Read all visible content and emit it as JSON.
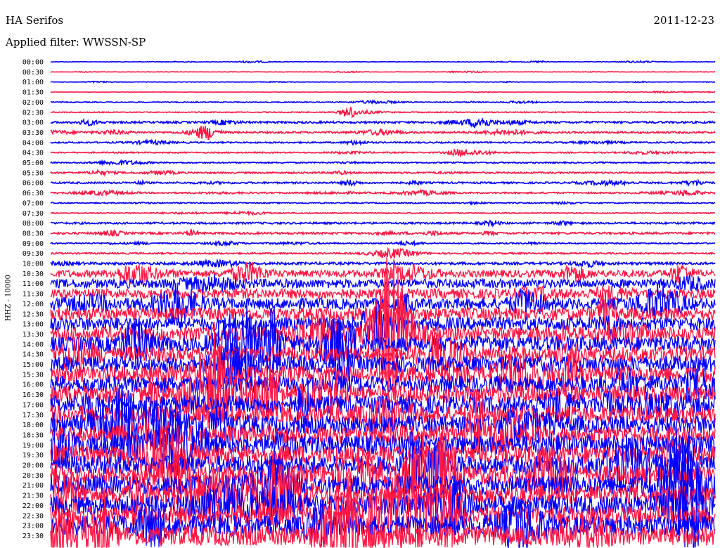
{
  "header": {
    "station": "HA Serifos",
    "date": "2011-12-23",
    "filter_label": "Applied filter: WWSSN-SP"
  },
  "chart_data": {
    "type": "line",
    "title": "HA Serifos",
    "subtitle": "Applied filter: WWSSN-SP",
    "ylabel": "HHZ - 10000",
    "xlabel": "",
    "grid": false,
    "row_interval_minutes": 30,
    "tick_labels": [
      "00:00",
      "00:30",
      "01:00",
      "01:30",
      "02:00",
      "02:30",
      "03:00",
      "03:30",
      "04:00",
      "04:30",
      "05:00",
      "05:30",
      "06:00",
      "06:30",
      "07:00",
      "07:30",
      "08:00",
      "08:30",
      "09:00",
      "09:30",
      "10:00",
      "10:30",
      "11:00",
      "11:30",
      "12:00",
      "12:30",
      "13:00",
      "13:30",
      "14:00",
      "14:30",
      "15:00",
      "15:30",
      "16:00",
      "16:30",
      "17:00",
      "17:30",
      "18:00",
      "18:30",
      "19:00",
      "19:30",
      "20:00",
      "20:30",
      "21:00",
      "21:30",
      "22:00",
      "22:30",
      "23:00",
      "23:30"
    ],
    "series": [
      {
        "name": "",
        "color": "#0000ff"
      },
      {
        "name": "",
        "color": "#ff1744"
      }
    ],
    "relative_amplitude": [
      0.12,
      0.1,
      0.1,
      0.08,
      0.2,
      0.22,
      0.45,
      0.4,
      0.32,
      0.28,
      0.3,
      0.35,
      0.38,
      0.33,
      0.25,
      0.22,
      0.42,
      0.45,
      0.3,
      0.35,
      0.55,
      1.6,
      2.0,
      2.2,
      2.5,
      2.8,
      3.0,
      3.2,
      3.4,
      3.5,
      3.6,
      3.7,
      3.8,
      3.9,
      4.0,
      4.0,
      4.1,
      4.1,
      4.2,
      4.2,
      4.2,
      4.2,
      4.3,
      4.3,
      4.3,
      4.3,
      4.4,
      4.4
    ]
  }
}
